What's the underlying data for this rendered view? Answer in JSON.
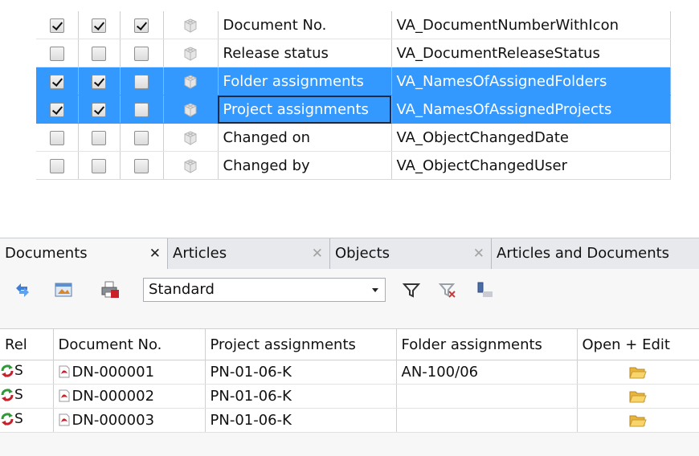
{
  "config_rows": [
    {
      "c1": true,
      "c2": true,
      "c3": true,
      "label": "Document No.",
      "field": "VA_DocumentNumberWithIcon",
      "selected": false,
      "focused": false
    },
    {
      "c1": false,
      "c2": false,
      "c3": false,
      "label": "Release status",
      "field": "VA_DocumentReleaseStatus",
      "selected": false,
      "focused": false
    },
    {
      "c1": true,
      "c2": true,
      "c3": false,
      "label": "Folder assignments",
      "field": "VA_NamesOfAssignedFolders",
      "selected": true,
      "focused": false
    },
    {
      "c1": true,
      "c2": true,
      "c3": false,
      "label": "Project assignments",
      "field": "VA_NamesOfAssignedProjects",
      "selected": true,
      "focused": true
    },
    {
      "c1": false,
      "c2": false,
      "c3": false,
      "label": "Changed on",
      "field": "VA_ObjectChangedDate",
      "selected": false,
      "focused": false
    },
    {
      "c1": false,
      "c2": false,
      "c3": false,
      "label": "Changed by",
      "field": "VA_ObjectChangedUser",
      "selected": false,
      "focused": false
    }
  ],
  "tabs": [
    {
      "label": "Documents",
      "close": "✕",
      "active": true
    },
    {
      "label": "Articles",
      "close": "✕",
      "active": false
    },
    {
      "label": "Objects",
      "close": "✕",
      "active": false
    },
    {
      "label": "Articles and Documents",
      "close": "",
      "active": false
    }
  ],
  "toolbar": {
    "icons": [
      "refresh-icon",
      "preview-icon",
      "print-icon",
      "filter-icon",
      "clear-filter-icon",
      "column-chooser-icon"
    ],
    "view_value": "Standard"
  },
  "list": {
    "columns": [
      "Rel",
      "Document No.",
      "Project assignments",
      "Folder assignments",
      "Open + Edit"
    ],
    "rows": [
      {
        "rel": "S",
        "doc": "DN-000001",
        "project": "PN-01-06-K",
        "folder": "AN-100/06"
      },
      {
        "rel": "S",
        "doc": "DN-000002",
        "project": "PN-01-06-K",
        "folder": ""
      },
      {
        "rel": "S",
        "doc": "DN-000003",
        "project": "PN-01-06-K",
        "folder": ""
      }
    ]
  },
  "colors": {
    "selection": "#3399ff",
    "tabbar": "#e7e9ec",
    "pdf_red": "#c8202a",
    "folder": "#f2c64a"
  }
}
